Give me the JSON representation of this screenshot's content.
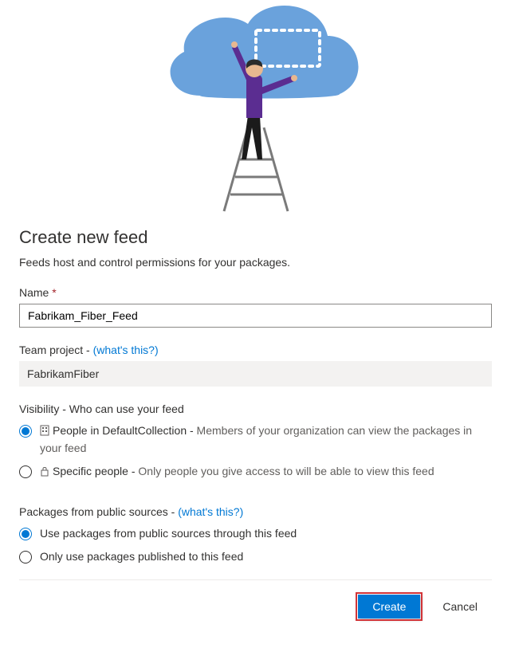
{
  "heading": "Create new feed",
  "subtitle": "Feeds host and control permissions for your packages.",
  "name": {
    "label": "Name",
    "required_marker": "*",
    "value": "Fabrikam_Fiber_Feed"
  },
  "team_project": {
    "label_prefix": "Team project - ",
    "help_link": "(what's this?)",
    "value": "FabrikamFiber"
  },
  "visibility": {
    "section_label": "Visibility - Who can use your feed",
    "options": [
      {
        "checked": true,
        "title": "People in DefaultCollection - ",
        "desc": "Members of your organization can view the packages in your feed"
      },
      {
        "checked": false,
        "title": "Specific people - ",
        "desc": "Only people you give access to will be able to view this feed"
      }
    ]
  },
  "sources": {
    "label_prefix": "Packages from public sources - ",
    "help_link": "(what's this?)",
    "options": [
      {
        "checked": true,
        "label": "Use packages from public sources through this feed"
      },
      {
        "checked": false,
        "label": "Only use packages published to this feed"
      }
    ]
  },
  "actions": {
    "create": "Create",
    "cancel": "Cancel"
  }
}
